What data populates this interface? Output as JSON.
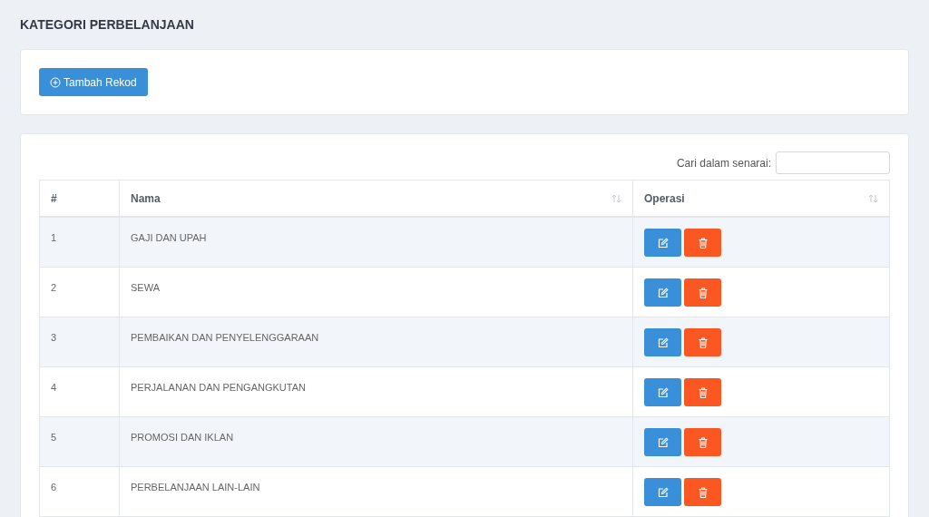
{
  "page_title": "KATEGORI PERBELANJAAN",
  "add_button": {
    "label": "Tambah Rekod"
  },
  "search": {
    "label": "Cari dalam senarai:"
  },
  "table": {
    "columns": [
      {
        "label": "#",
        "sortable": false
      },
      {
        "label": "Nama",
        "sortable": true
      },
      {
        "label": "Operasi",
        "sortable": true
      }
    ],
    "rows": [
      {
        "number": "1",
        "name": "GAJI DAN UPAH"
      },
      {
        "number": "2",
        "name": "SEWA"
      },
      {
        "number": "3",
        "name": "PEMBAIKAN DAN PENYELENGGARAAN"
      },
      {
        "number": "4",
        "name": "PERJALANAN DAN PENGANGKUTAN"
      },
      {
        "number": "5",
        "name": "PROMOSI DAN IKLAN"
      },
      {
        "number": "6",
        "name": "PERBELANJAAN LAIN-LAIN"
      }
    ]
  }
}
